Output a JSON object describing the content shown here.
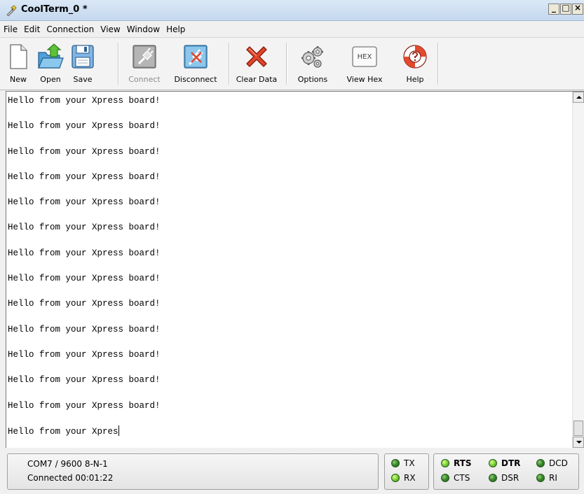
{
  "window": {
    "title": "CoolTerm_0 *",
    "controls": {
      "minimize": "_",
      "maximize": "□",
      "close": "×"
    }
  },
  "menu": {
    "items": [
      "File",
      "Edit",
      "Connection",
      "View",
      "Window",
      "Help"
    ]
  },
  "toolbar": {
    "new_label": "New",
    "open_label": "Open",
    "save_label": "Save",
    "connect_label": "Connect",
    "disconnect_label": "Disconnect",
    "clear_label": "Clear Data",
    "options_label": "Options",
    "viewhex_label": "View Hex",
    "viewhex_icon_text": "HEX",
    "help_label": "Help",
    "connect_enabled": false
  },
  "terminal": {
    "lines": [
      "Hello from your Xpress board!",
      "Hello from your Xpress board!",
      "Hello from your Xpress board!",
      "Hello from your Xpress board!",
      "Hello from your Xpress board!",
      "Hello from your Xpress board!",
      "Hello from your Xpress board!",
      "Hello from your Xpress board!",
      "Hello from your Xpress board!",
      "Hello from your Xpress board!",
      "Hello from your Xpress board!",
      "Hello from your Xpress board!",
      "Hello from your Xpress board!",
      "Hello from your Xpres"
    ]
  },
  "status": {
    "port": "COM7 / 9600 8-N-1",
    "connection": "Connected 00:01:22",
    "leds": {
      "tx": {
        "label": "TX",
        "state": "off"
      },
      "rx": {
        "label": "RX",
        "state": "on"
      },
      "rts": {
        "label": "RTS",
        "state": "on"
      },
      "cts": {
        "label": "CTS",
        "state": "off"
      },
      "dtr": {
        "label": "DTR",
        "state": "on"
      },
      "dsr": {
        "label": "DSR",
        "state": "off"
      },
      "dcd": {
        "label": "DCD",
        "state": "off"
      },
      "ri": {
        "label": "RI",
        "state": "off"
      }
    }
  },
  "colors": {
    "led_on": "#7fd43a",
    "led_off": "#3b8a2a",
    "clear_x": "#e0452c"
  }
}
